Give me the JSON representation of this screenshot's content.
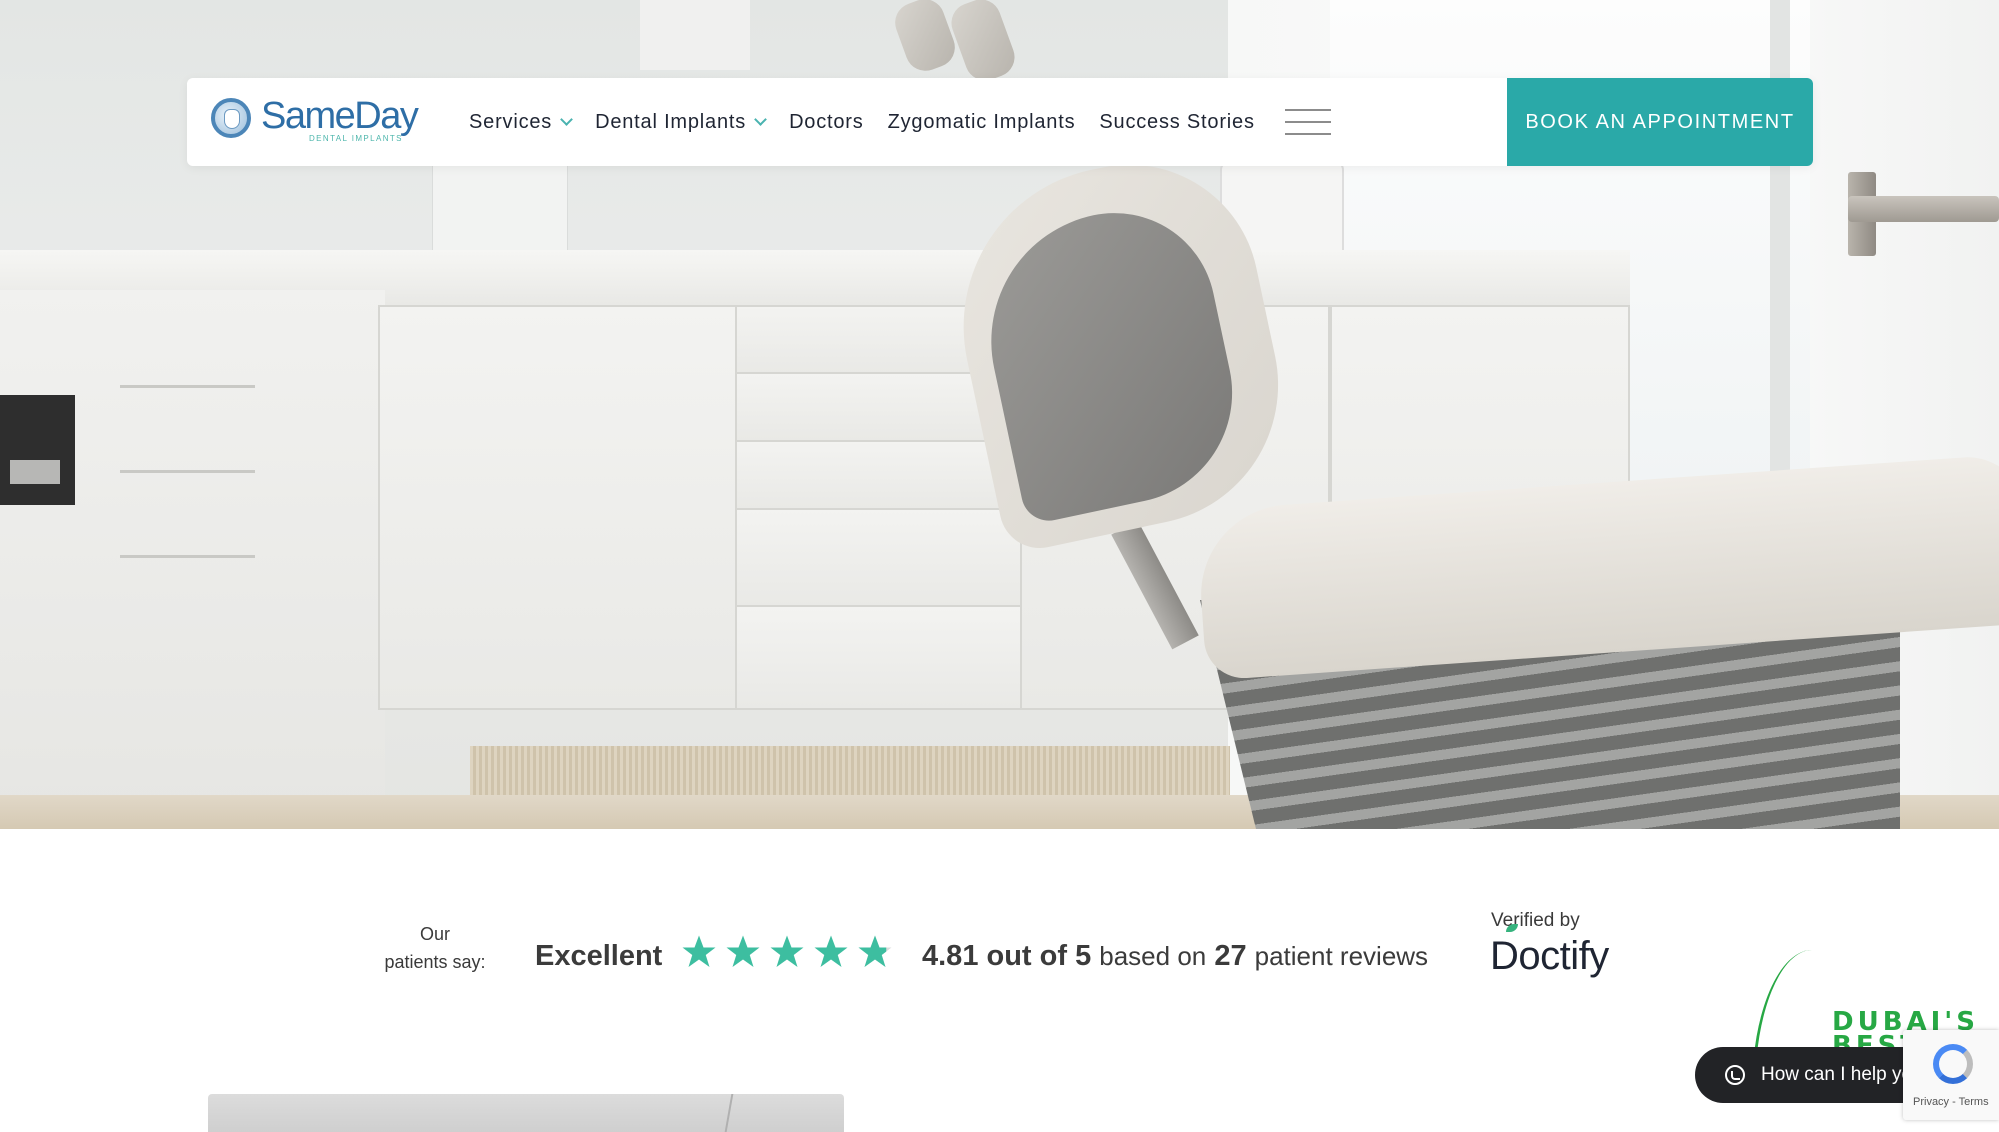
{
  "header": {
    "logo": {
      "name": "SameDay",
      "tagline": "DENTAL IMPLANTS"
    },
    "nav": [
      {
        "label": "Services",
        "has_dropdown": true
      },
      {
        "label": "Dental Implants",
        "has_dropdown": true
      },
      {
        "label": "Doctors",
        "has_dropdown": false
      },
      {
        "label": "Zygomatic Implants",
        "has_dropdown": false
      },
      {
        "label": "Success Stories",
        "has_dropdown": false
      }
    ],
    "menu_icon": "hamburger-icon",
    "cta_label": "BOOK AN APPOINTMENT"
  },
  "colors": {
    "accent": "#2aa9a8",
    "star": "#3dbea0",
    "nav_text": "#1f2533",
    "badge_green": "#27a844",
    "chat_bg": "#222326"
  },
  "reviews": {
    "lead_line1": "Our",
    "lead_line2": "patients say:",
    "rating_word": "Excellent",
    "stars": 4.81,
    "stars_max": 5,
    "score": "4.81 out of 5",
    "based_on": "based on",
    "count": "27",
    "suffix": "patient reviews",
    "verified_by": "Verified by",
    "provider": "Doctify"
  },
  "widgets": {
    "badge_text_line1": "DUBAI'S",
    "badge_text_line2": "BEST",
    "chat_label": "How can I help you?",
    "chat_icon": "whatsapp-icon",
    "recaptcha_links": "Privacy - Terms"
  }
}
